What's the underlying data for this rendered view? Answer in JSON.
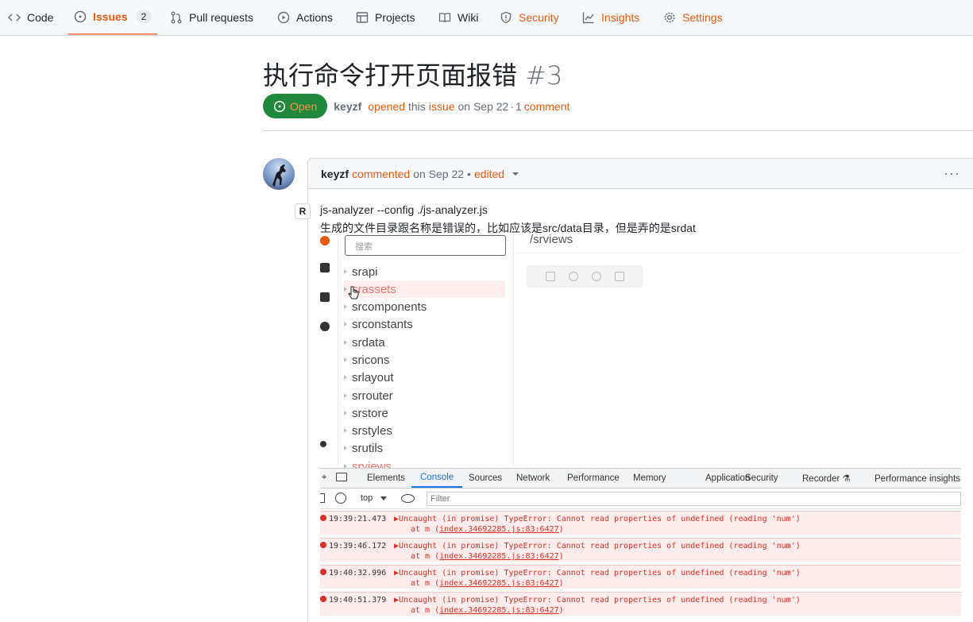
{
  "nav": {
    "code": "Code",
    "issues": "Issues",
    "issues_count": "2",
    "pulls": "Pull requests",
    "actions": "Actions",
    "projects": "Projects",
    "wiki": "Wiki",
    "security": "Security",
    "insights": "Insights",
    "settings": "Settings"
  },
  "issue": {
    "title": "执行命令打开页面报错",
    "number": "#3",
    "state": "Open",
    "author": "keyzf",
    "opened": "opened",
    "this": "this",
    "issue_word": "issue",
    "date": "on Sep 22",
    "sep": "·",
    "comment_count": "1",
    "comment_word": "comment"
  },
  "comment": {
    "author": "keyzf",
    "commented": "commented",
    "date": "on Sep 22",
    "bullet": "•",
    "edited": "edited",
    "more": "···",
    "badge": "R",
    "line1": "js-analyzer --config ./js-analyzer.js",
    "line2": "生成的文件目录跟名称是错误的，比如应该是src/data目录，但是弄的是srdat"
  },
  "screenshot": {
    "search_placeholder": "搜索",
    "tree": [
      "srapi",
      "srassets",
      "srcomponents",
      "srconstants",
      "srdata",
      "sricons",
      "srlayout",
      "srrouter",
      "srstore",
      "srstyles",
      "srutils",
      "srviews"
    ],
    "right_title": "/srviews",
    "devtools_tabs": [
      "Elements",
      "Console",
      "Sources",
      "Network",
      "Performance",
      "Memory",
      "Application",
      "Security",
      "Recorder ⚗",
      "Performance insights ⚗"
    ],
    "context": "top",
    "filter_placeholder": "Filter",
    "logs": [
      {
        "time": "19:39:21.473",
        "msg": "▶Uncaught (in promise) TypeError: Cannot read properties of undefined (reading 'num')",
        "at": "at m (",
        "file": "index.34692285.js:83:6427",
        "close": ")"
      },
      {
        "time": "19:39:46.172",
        "msg": "▶Uncaught (in promise) TypeError: Cannot read properties of undefined (reading 'num')",
        "at": "at m (",
        "file": "index.34692285.js:83:6427",
        "close": ")"
      },
      {
        "time": "19:40:32.996",
        "msg": "▶Uncaught (in promise) TypeError: Cannot read properties of undefined (reading 'num')",
        "at": "at m (",
        "file": "index.34692285.js:83:6427",
        "close": ")"
      },
      {
        "time": "19:40:51.379",
        "msg": "▶Uncaught (in promise) TypeError: Cannot read properties of undefined (reading 'num')",
        "at": "at m (",
        "file": "index.34692285.js:83:6427",
        "close": ")"
      }
    ]
  }
}
